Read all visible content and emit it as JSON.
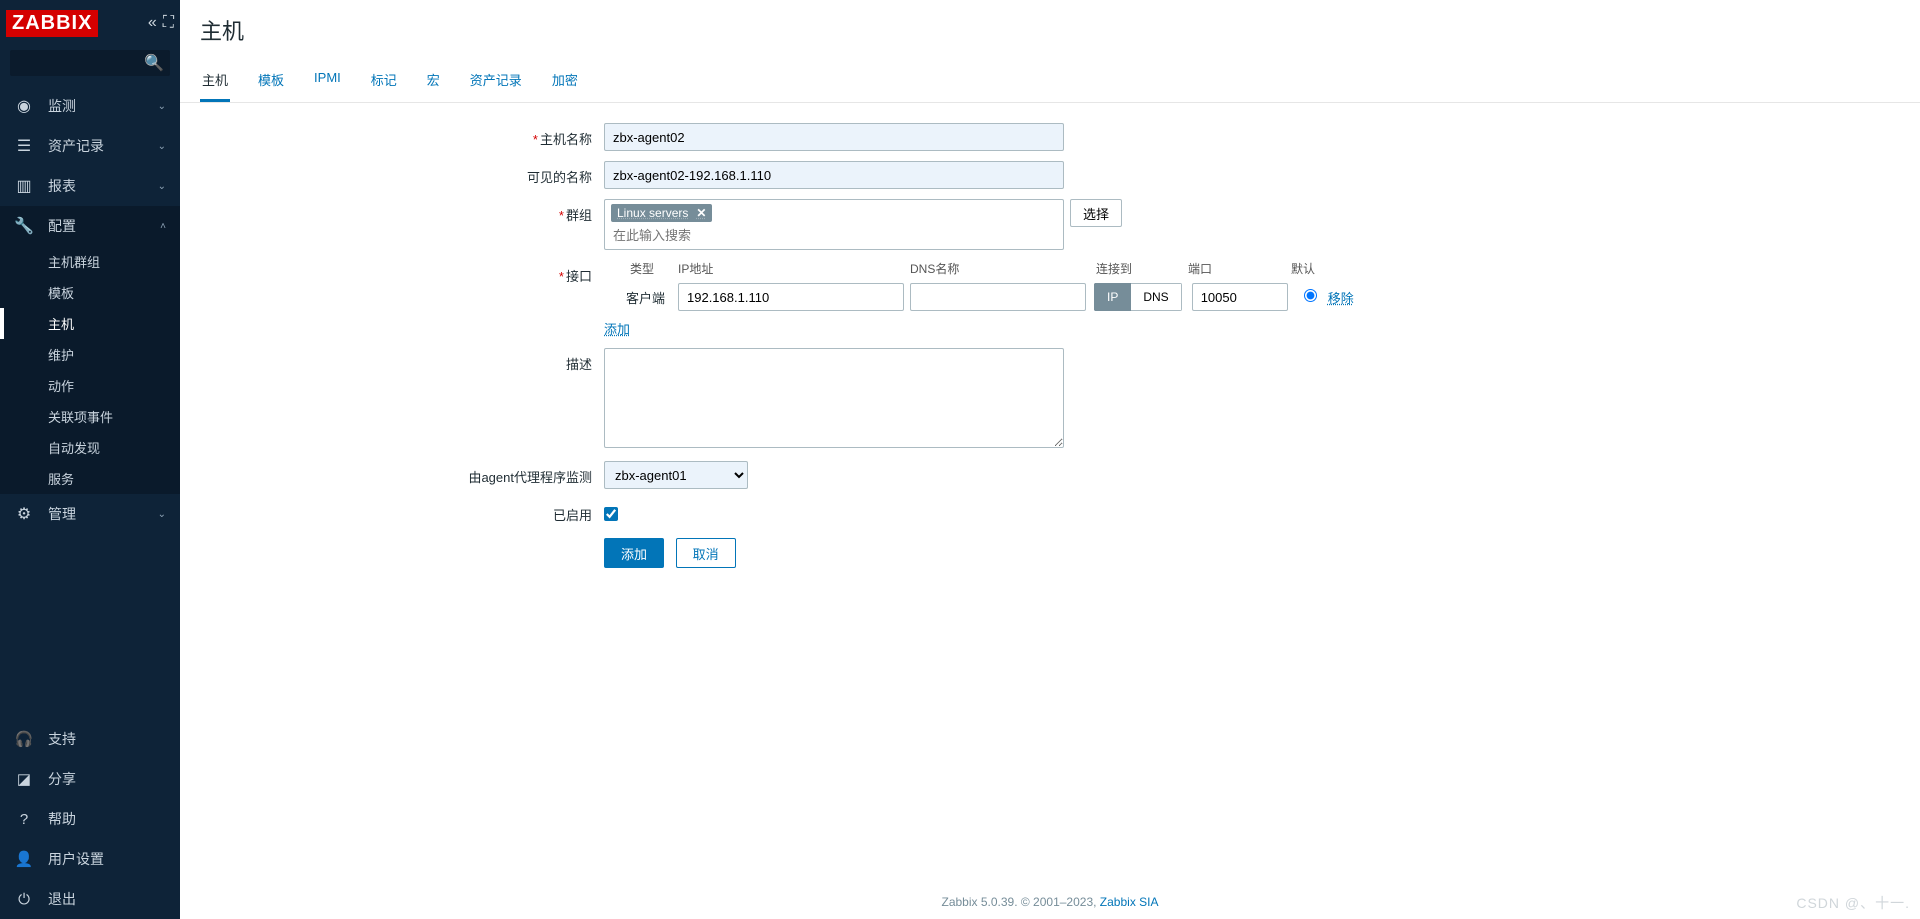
{
  "brand": "ZABBIX",
  "search": {
    "placeholder": ""
  },
  "nav": {
    "items": [
      {
        "label": "监测",
        "icon": "◉"
      },
      {
        "label": "资产记录",
        "icon": "☰"
      },
      {
        "label": "报表",
        "icon": "▥"
      },
      {
        "label": "配置",
        "icon": "🔧"
      },
      {
        "label": "管理",
        "icon": "⚙"
      }
    ],
    "config_sub": [
      {
        "label": "主机群组"
      },
      {
        "label": "模板"
      },
      {
        "label": "主机"
      },
      {
        "label": "维护"
      },
      {
        "label": "动作"
      },
      {
        "label": "关联项事件"
      },
      {
        "label": "自动发现"
      },
      {
        "label": "服务"
      }
    ],
    "bottom": [
      {
        "label": "支持",
        "icon": "🎧"
      },
      {
        "label": "分享",
        "icon": "◪"
      },
      {
        "label": "帮助",
        "icon": "?"
      },
      {
        "label": "用户设置",
        "icon": "👤"
      },
      {
        "label": "退出",
        "icon": "⏻"
      }
    ]
  },
  "page": {
    "title": "主机"
  },
  "tabs": [
    {
      "label": "主机",
      "active": true
    },
    {
      "label": "模板"
    },
    {
      "label": "IPMI"
    },
    {
      "label": "标记"
    },
    {
      "label": "宏"
    },
    {
      "label": "资产记录"
    },
    {
      "label": "加密"
    }
  ],
  "form": {
    "labels": {
      "hostname": "主机名称",
      "visiblename": "可见的名称",
      "groups": "群组",
      "select_btn": "选择",
      "groups_placeholder": "在此输入搜索",
      "interfaces": "接口",
      "if_type": "类型",
      "if_ip": "IP地址",
      "if_dns": "DNS名称",
      "if_connect": "连接到",
      "if_port": "端口",
      "if_default": "默认",
      "agent_row_type": "客户端",
      "seg_ip": "IP",
      "seg_dns": "DNS",
      "remove": "移除",
      "add_link": "添加",
      "description": "描述",
      "proxy": "由agent代理程序监测",
      "enabled": "已启用",
      "btn_add": "添加",
      "btn_cancel": "取消"
    },
    "values": {
      "hostname": "zbx-agent02",
      "visiblename": "zbx-agent02-192.168.1.110",
      "group_tag": "Linux servers",
      "if_ip": "192.168.1.110",
      "if_dns": "",
      "if_port": "10050",
      "proxy": "zbx-agent01",
      "enabled": true
    }
  },
  "footer": {
    "text": "Zabbix 5.0.39. © 2001–2023, ",
    "link": "Zabbix SIA"
  },
  "watermark": "CSDN @、十一."
}
